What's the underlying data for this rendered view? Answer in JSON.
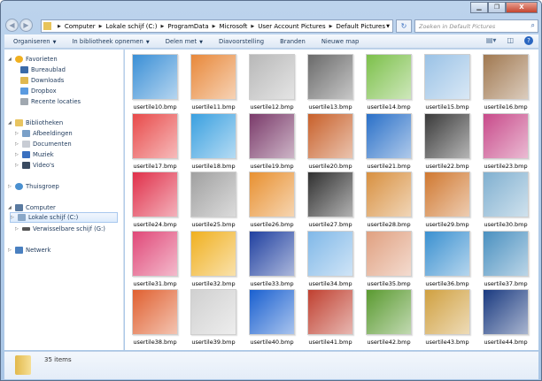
{
  "window": {
    "minimize": "▁",
    "maximize": "❐",
    "close": "X"
  },
  "address": {
    "crumbs": [
      "Computer",
      "Lokale schijf (C:)",
      "ProgramData",
      "Microsoft",
      "User Account Pictures",
      "Default Pictures"
    ],
    "search_placeholder": "Zoeken in Default Pictures"
  },
  "toolbar": {
    "organize": "Organiseren",
    "library": "In bibliotheek opnemen",
    "share": "Delen met",
    "slideshow": "Diavoorstelling",
    "burn": "Branden",
    "new_folder": "Nieuwe map"
  },
  "nav": {
    "favorites": "Favorieten",
    "desktop": "Bureaublad",
    "downloads": "Downloads",
    "dropbox": "Dropbox",
    "recent": "Recente locaties",
    "libraries": "Bibliotheken",
    "pictures": "Afbeeldingen",
    "documents": "Documenten",
    "music": "Muziek",
    "videos": "Video's",
    "homegroup": "Thuisgroep",
    "computer": "Computer",
    "local_disk": "Lokale schijf (C:)",
    "removable": "Verwisselbare schijf (G:)",
    "network": "Netwerk"
  },
  "files": [
    {
      "name": "usertile10.bmp",
      "color": "#3a8fd6"
    },
    {
      "name": "usertile11.bmp",
      "color": "#e8883a"
    },
    {
      "name": "usertile12.bmp",
      "color": "#b8b8b8"
    },
    {
      "name": "usertile13.bmp",
      "color": "#6a6a6a"
    },
    {
      "name": "usertile14.bmp",
      "color": "#7cc04a"
    },
    {
      "name": "usertile15.bmp",
      "color": "#9ac2e6"
    },
    {
      "name": "usertile16.bmp",
      "color": "#a07850"
    },
    {
      "name": "usertile17.bmp",
      "color": "#e84a4a"
    },
    {
      "name": "usertile18.bmp",
      "color": "#3aa0e0"
    },
    {
      "name": "usertile19.bmp",
      "color": "#7a3a6a"
    },
    {
      "name": "usertile20.bmp",
      "color": "#c8602a"
    },
    {
      "name": "usertile21.bmp",
      "color": "#2a70c8"
    },
    {
      "name": "usertile22.bmp",
      "color": "#3a3a3a"
    },
    {
      "name": "usertile23.bmp",
      "color": "#c84a8a"
    },
    {
      "name": "usertile24.bmp",
      "color": "#e0304a"
    },
    {
      "name": "usertile25.bmp",
      "color": "#a0a0a0"
    },
    {
      "name": "usertile26.bmp",
      "color": "#e89030"
    },
    {
      "name": "usertile27.bmp",
      "color": "#303030"
    },
    {
      "name": "usertile28.bmp",
      "color": "#d89040"
    },
    {
      "name": "usertile29.bmp",
      "color": "#d07830"
    },
    {
      "name": "usertile30.bmp",
      "color": "#80b0d0"
    },
    {
      "name": "usertile31.bmp",
      "color": "#e04878"
    },
    {
      "name": "usertile32.bmp",
      "color": "#f0b020"
    },
    {
      "name": "usertile33.bmp",
      "color": "#2040a0"
    },
    {
      "name": "usertile34.bmp",
      "color": "#80b8e8"
    },
    {
      "name": "usertile35.bmp",
      "color": "#e0a080"
    },
    {
      "name": "usertile36.bmp",
      "color": "#3a90d0"
    },
    {
      "name": "usertile37.bmp",
      "color": "#4a90c0"
    },
    {
      "name": "usertile38.bmp",
      "color": "#e06030"
    },
    {
      "name": "usertile39.bmp",
      "color": "#d0d0d0"
    },
    {
      "name": "usertile40.bmp",
      "color": "#1a60d0"
    },
    {
      "name": "usertile41.bmp",
      "color": "#c04030"
    },
    {
      "name": "usertile42.bmp",
      "color": "#5a9a30"
    },
    {
      "name": "usertile43.bmp",
      "color": "#d0a040"
    },
    {
      "name": "usertile44.bmp",
      "color": "#1a3a80"
    }
  ],
  "status": {
    "count": "35 items"
  }
}
